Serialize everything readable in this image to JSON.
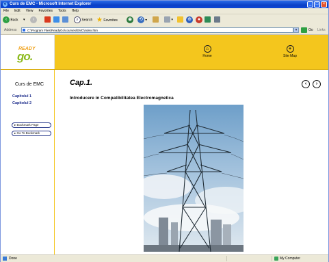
{
  "window": {
    "title": "Curs de EMC - Microsoft Internet Explorer"
  },
  "menu": [
    "File",
    "Edit",
    "View",
    "Favorites",
    "Tools",
    "Help"
  ],
  "toolbar": {
    "back_label": "Back",
    "search_label": "Search",
    "favorites_label": "Favorites"
  },
  "address": {
    "label": "Address",
    "url": "C:\\Program Files\\ReadyGo\\courses\\EMC\\index.htm",
    "go_label": "Go",
    "links_label": "Links"
  },
  "site": {
    "logo_top": "READY",
    "logo_bottom": "go.",
    "nav": [
      {
        "label": "Home",
        "icon": "home-icon"
      },
      {
        "label": "Site Map",
        "icon": "sitemap-icon"
      }
    ],
    "course_title": "Curs de EMC",
    "chapters": [
      "Capitolul 1",
      "Capitolul 2"
    ],
    "bookmark_page": "Bookmark Page",
    "goto_bookmark": "Go To Bookmark"
  },
  "main": {
    "chapter_heading": "Cap.1.",
    "subtitle": "Introducere in Compatibilitatea Electromagnetica"
  },
  "status": {
    "text": "Done",
    "zone": "My Computer"
  }
}
